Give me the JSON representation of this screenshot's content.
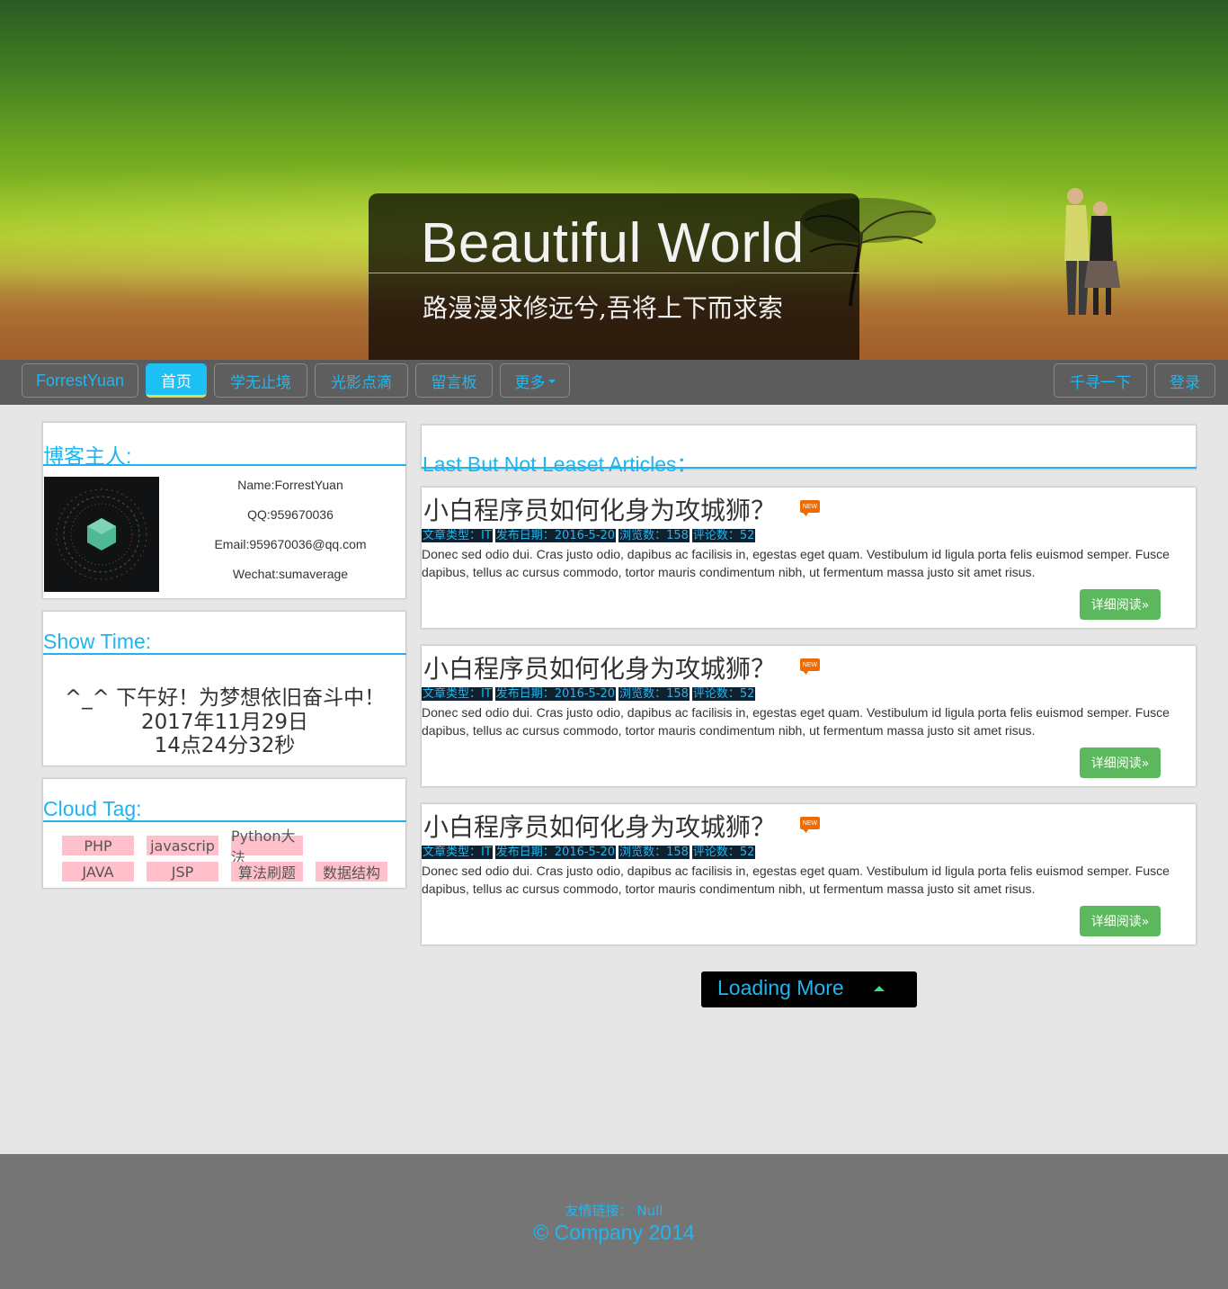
{
  "hero": {
    "title": "Beautiful World",
    "subtitle": "路漫漫求修远兮,吾将上下而求索"
  },
  "nav": {
    "brand": "ForrestYuan",
    "items": [
      {
        "label": "首页",
        "active": true
      },
      {
        "label": "学无止境"
      },
      {
        "label": "光影点滴"
      },
      {
        "label": "留言板"
      },
      {
        "label": "更多"
      }
    ],
    "search_label": "千寻一下",
    "login_label": "登录"
  },
  "owner": {
    "heading": "博客主人:",
    "name": "Name:ForrestYuan",
    "qq": "QQ:959670036",
    "email": "Email:959670036@qq.com",
    "wechat": "Wechat:sumaverage"
  },
  "show_time": {
    "heading": "Show Time:",
    "greeting": "^_^ 下午好！为梦想依旧奋斗中！",
    "date": "2017年11月29日",
    "time": "14点24分32秒"
  },
  "cloud_tag": {
    "heading": "Cloud Tag:",
    "tags": [
      "PHP",
      "javascrip",
      "Python大法",
      "JAVA",
      "JSP",
      "算法刷题",
      "数据结构"
    ]
  },
  "articles_section": {
    "heading": "Last But Not Leaset Articles："
  },
  "articles": [
    {
      "title": "小白程序员如何化身为攻城狮？",
      "badge": "NEW",
      "type": "文章类型：IT",
      "date": "发布日期：2016-5-20",
      "views": "浏览数：158",
      "comments": "评论数：52",
      "body": "Donec sed odio dui. Cras justo odio, dapibus ac facilisis in, egestas eget quam. Vestibulum id ligula porta felis euismod semper. Fusce dapibus, tellus ac cursus commodo, tortor mauris condimentum nibh, ut fermentum massa justo sit amet risus.",
      "button": "详细阅读»"
    },
    {
      "title": "小白程序员如何化身为攻城狮？",
      "badge": "NEW",
      "type": "文章类型：IT",
      "date": "发布日期：2016-5-20",
      "views": "浏览数：158",
      "comments": "评论数：52",
      "body": "Donec sed odio dui. Cras justo odio, dapibus ac facilisis in, egestas eget quam. Vestibulum id ligula porta felis euismod semper. Fusce dapibus, tellus ac cursus commodo, tortor mauris condimentum nibh, ut fermentum massa justo sit amet risus.",
      "button": "详细阅读»"
    },
    {
      "title": "小白程序员如何化身为攻城狮？",
      "badge": "NEW",
      "type": "文章类型：IT",
      "date": "发布日期：2016-5-20",
      "views": "浏览数：158",
      "comments": "评论数：52",
      "body": "Donec sed odio dui. Cras justo odio, dapibus ac facilisis in, egestas eget quam. Vestibulum id ligula porta felis euismod semper. Fusce dapibus, tellus ac cursus commodo, tortor mauris condimentum nibh, ut fermentum massa justo sit amet risus.",
      "button": "详细阅读»"
    }
  ],
  "loading_more": "Loading More",
  "footer": {
    "links": "友情链接： Null",
    "copyright": "© Company 2014"
  },
  "colors": {
    "accent": "#1fb4ee",
    "nav_active": "#1cc0f5",
    "button_green": "#5cb85c",
    "tag_pink": "#ffc0cb",
    "footer_bg": "#757575"
  }
}
